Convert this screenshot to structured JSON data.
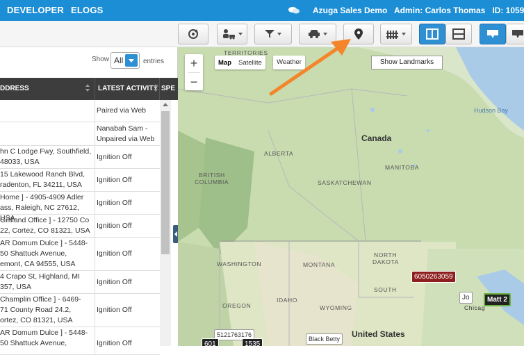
{
  "topbar": {
    "nav": [
      "DEVELOPER",
      "ELOGS"
    ],
    "account": "Azuga Sales Demo",
    "admin": "Admin: Carlos Thomas",
    "id": "ID: 1059"
  },
  "toolbar": {
    "icons": [
      "refresh-icon",
      "driver-icon",
      "filter-icon",
      "vehicle-icon",
      "landmark-icon",
      "geofence-icon",
      "split-vertical-icon",
      "split-horizontal-icon",
      "message-icon",
      "message-alt-icon"
    ]
  },
  "table": {
    "show_label": "Show",
    "show_value": "All",
    "entries_label": "entries",
    "headers": [
      "DDRESS",
      "LATEST ACTIVITY",
      "SPE"
    ],
    "rows": [
      {
        "address": "",
        "activity": "Paired via Web"
      },
      {
        "address": "",
        "activity": "Nanabah Sam -\nUnpaired via Web"
      },
      {
        "address": "hn C Lodge Fwy, Southfield,\n 48033, USA",
        "activity": "Ignition Off"
      },
      {
        "address": "15 Lakewood Ranch Blvd,\nradenton, FL 34211, USA",
        "activity": "Ignition Off"
      },
      {
        "address": "Home ] - 4905-4909 Adler\nass, Raleigh, NC 27612, USA",
        "activity": "Ignition Off"
      },
      {
        "address": "Gilliland Office ] - 12750 Co\n22, Cortez, CO 81321, USA",
        "activity": "Ignition Off"
      },
      {
        "address": "AR Domum Dulce ] - 5448-\n50 Shattuck Avenue,\nemont, CA 94555, USA",
        "activity": "Ignition Off"
      },
      {
        "address": "4 Crapo St, Highland, MI\n357, USA",
        "activity": "Ignition Off"
      },
      {
        "address": "Champlin Office ] - 6469-\n71 County Road 24.2,\nortez, CO 81321, USA",
        "activity": "Ignition Off"
      },
      {
        "address": "AR Domum Dulce ] - 5448-\n50 Shattuck Avenue,",
        "activity": "Ignition Off"
      }
    ]
  },
  "map": {
    "zoom_in": "+",
    "zoom_out": "−",
    "map_type": [
      "Map",
      "Satellite"
    ],
    "weather": "Weather",
    "tooltip": "Show Landmarks",
    "labels": {
      "territories": "TERRITORIES",
      "canada": "Canada",
      "hudson": "Hudson Bay",
      "alberta": "ALBERTA",
      "bc1": "BRITISH",
      "bc2": "COLUMBIA",
      "manitoba": "MANITOBA",
      "sask": "SASKATCHEWAN",
      "washington": "WASHINGTON",
      "montana": "MONTANA",
      "nd1": "NORTH",
      "nd2": "DAKOTA",
      "sd": "SOUTH",
      "oregon": "OREGON",
      "idaho": "IDAHO",
      "wyoming": "WYOMING",
      "us": "United States",
      "chicago": "Chicag"
    },
    "vehicles": {
      "v1": "6050263059",
      "v2": "Matt 2",
      "v3": "Jo",
      "v4": "5121763176",
      "v5": "601",
      "v6": "1535",
      "v7": "Black Betty"
    }
  }
}
